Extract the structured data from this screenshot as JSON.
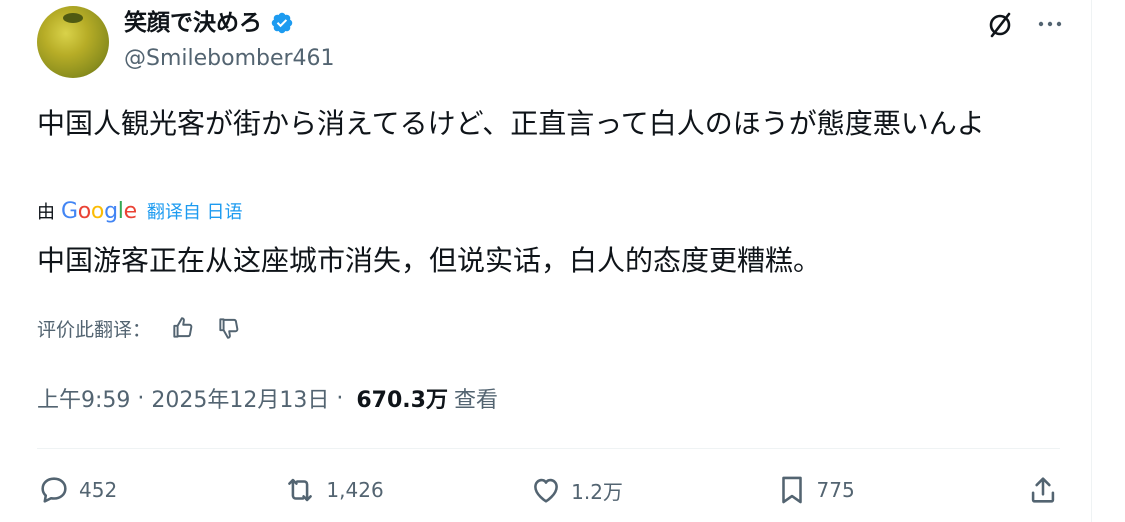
{
  "user": {
    "display_name": "笑顔で決めろ",
    "handle": "@Smilebomber461",
    "verified": true,
    "avatar_icon": "citrus-fruit-avatar"
  },
  "header_actions": {
    "grok_icon": "slashed-circle-icon",
    "more_icon": "more-dots-icon"
  },
  "tweet": {
    "text": "中国人観光客が街から消えてるけど、正直言って白人のほうが態度悪いんよ"
  },
  "translation": {
    "by_label": "由",
    "provider": "Google",
    "link_label": "翻译自 日语",
    "text": "中国游客正在从这座城市消失，但说实话，白人的态度更糟糕。",
    "rate_label": "评价此翻译："
  },
  "meta": {
    "time": "上午9:59",
    "separator1": " · ",
    "date": "2025年12月13日",
    "separator2": " · ",
    "views": "670.3万",
    "views_label": "查看"
  },
  "actions": {
    "reply_count": "452",
    "retweet_count": "1,426",
    "like_count": "1.2万",
    "bookmark_count": "775"
  },
  "colors": {
    "accent": "#1d9bf0",
    "muted": "#536471",
    "text": "#0f1419",
    "divider": "#eff3f4"
  }
}
